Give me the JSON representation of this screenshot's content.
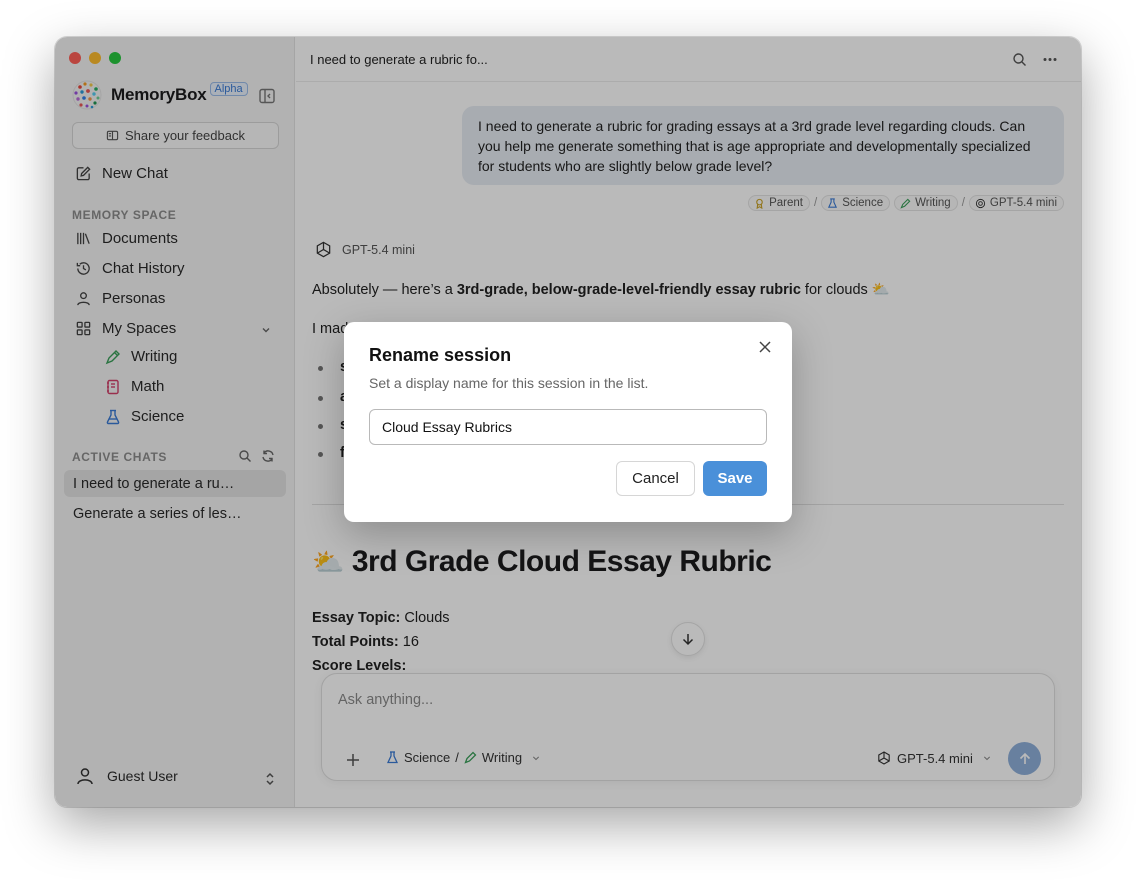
{
  "brand": {
    "name": "MemoryBox",
    "badge": "Alpha"
  },
  "sidebar": {
    "feedback_label": "Share your feedback",
    "new_chat_label": "New Chat",
    "memory_space_label": "MEMORY SPACE",
    "nav": [
      {
        "label": "Documents",
        "icon": "books-icon"
      },
      {
        "label": "Chat History",
        "icon": "history-icon"
      },
      {
        "label": "Personas",
        "icon": "person-icon"
      },
      {
        "label": "My Spaces",
        "icon": "grid-icon"
      }
    ],
    "spaces": [
      {
        "label": "Writing",
        "icon": "pen-icon",
        "color": "#3aa05a"
      },
      {
        "label": "Math",
        "icon": "notebook-icon",
        "color": "#d2416a"
      },
      {
        "label": "Science",
        "icon": "flask-icon",
        "color": "#3a7bd5"
      }
    ],
    "active_chats_label": "ACTIVE CHATS",
    "chats": [
      {
        "label": "I need to generate a ru…"
      },
      {
        "label": "Generate a series of les…"
      }
    ],
    "user_label": "Guest User"
  },
  "header": {
    "session_title": "I need to generate a rubric fo..."
  },
  "conversation": {
    "user_message": "I need to generate a rubric for grading essays at a 3rd grade level regarding clouds. Can you help me generate something that is age appropriate and developmentally specialized for students who are slightly below grade level?",
    "tags": [
      {
        "label": "Parent",
        "icon": "award-icon"
      },
      {
        "label": "Science",
        "icon": "flask-icon"
      },
      {
        "label": "Writing",
        "icon": "pen-icon"
      },
      {
        "label": "GPT-5.4 mini",
        "icon": "openai-icon"
      }
    ],
    "tag_separator": "/",
    "model_name": "GPT-5.4 mini",
    "reply_prefix": "Absolutely — here’s a ",
    "reply_bold": "3rd-grade, below-grade-level-friendly essay rubric",
    "reply_suffix": " for clouds ⛅",
    "reply_line2": "I mad",
    "bullets": [
      "s",
      "a",
      "s",
      "f"
    ],
    "rubric_title": "3rd Grade Cloud Essay Rubric",
    "rubric_emoji": "⛅",
    "essay_topic_label": "Essay Topic:",
    "essay_topic_value": " Clouds",
    "total_points_label": "Total Points:",
    "total_points_value": " 16",
    "score_levels_label": "Score Levels:"
  },
  "composer": {
    "placeholder": "Ask anything...",
    "space_a": "Science",
    "space_sep": "/",
    "space_b": "Writing",
    "model": "GPT-5.4 mini"
  },
  "modal": {
    "title": "Rename session",
    "subtitle": "Set a display name for this session in the list.",
    "input_value": "Cloud Essay Rubrics",
    "cancel_label": "Cancel",
    "save_label": "Save",
    "accent": "#4a90d9"
  }
}
